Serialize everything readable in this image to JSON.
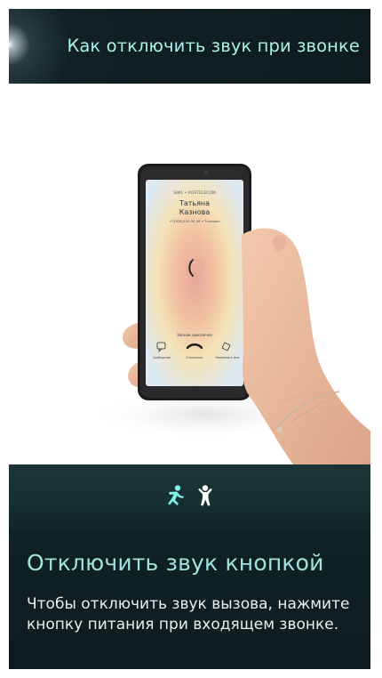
{
  "header": {
    "title": "Как отключить звук при звонке"
  },
  "photo": {
    "phone_screen": {
      "carrier": "SIM1 • ROSTELECOM",
      "caller_name_line1": "Татьяна",
      "caller_name_line2": "Казнова",
      "caller_number": "+7(928)100 00 46 • Телефон",
      "status_text": "Звонок выключен",
      "actions": [
        "Сообщение",
        "Отклонить",
        "Напомнить мне"
      ]
    }
  },
  "indicators": {
    "count": 2,
    "active_index": 0,
    "active_color": "#7ff0e5",
    "inactive_color": "#ffffff"
  },
  "content": {
    "title": "Отключить звук кнопкой",
    "text": "Чтобы отключить звук вызова, нажмите кнопку питания при входящем звонке."
  },
  "colors": {
    "accent": "#a8f1ea",
    "background": "#0f1d20"
  }
}
